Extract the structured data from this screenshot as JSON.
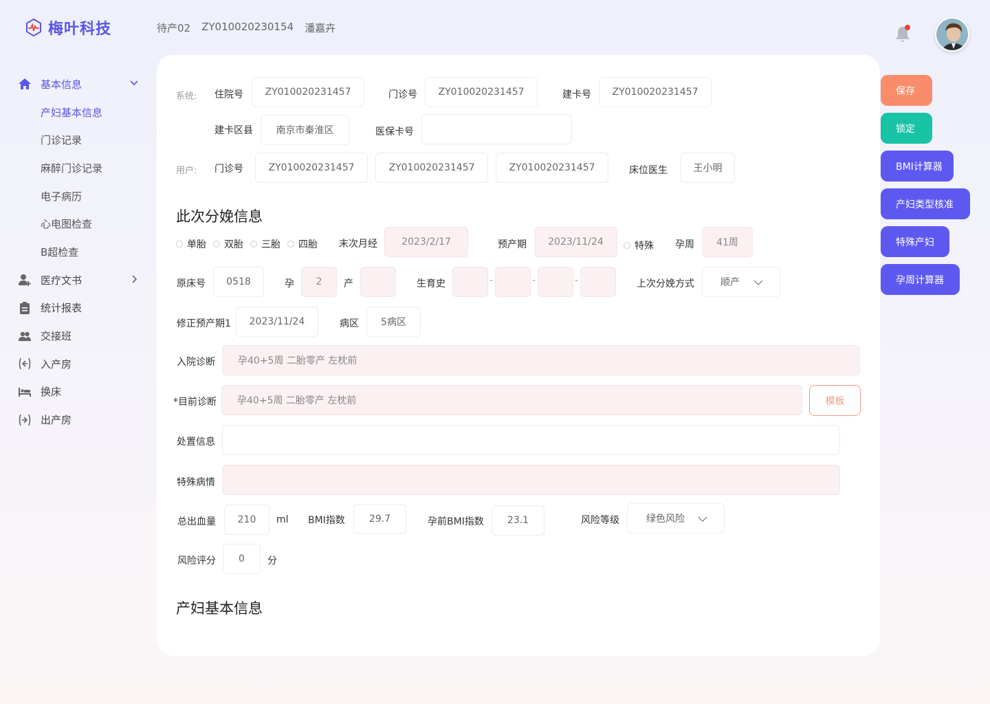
{
  "app": {
    "logo_text": "梅叶科技"
  },
  "header": {
    "status": "待产02",
    "record_no": "ZY010020230154",
    "patient_name": "潘嘉卉"
  },
  "sidebar": {
    "items": [
      {
        "label": "基本信息",
        "icon": "home-icon"
      },
      {
        "label": "产妇基本信息"
      },
      {
        "label": "门诊记录"
      },
      {
        "label": "麻醉门诊记录"
      },
      {
        "label": "电子病历"
      },
      {
        "label": "心电图检查"
      },
      {
        "label": "B超检查"
      },
      {
        "label": "医疗文书",
        "icon": "user-add-icon"
      },
      {
        "label": "统计报表",
        "icon": "clipboard-icon"
      },
      {
        "label": "交接班",
        "icon": "users-icon"
      },
      {
        "label": "入产房",
        "icon": "enter-room-icon"
      },
      {
        "label": "换床",
        "icon": "bed-icon"
      },
      {
        "label": "出产房",
        "icon": "exit-room-icon"
      }
    ]
  },
  "form": {
    "system_label": "系统:",
    "user_label": "用户:",
    "hospital_no_label": "住院号",
    "hospital_no": "ZY010020231457",
    "clinic_no_label": "门诊号",
    "clinic_no": "ZY010020231457",
    "card_no_label": "建卡号",
    "card_no": "ZY010020231457",
    "card_district_label": "建卡区县",
    "card_district": "南京市秦淮区",
    "insurance_label": "医保卡号",
    "insurance": "",
    "user_clinic_label": "门诊号",
    "user_clinic_1": "ZY010020231457",
    "user_clinic_2": "ZY010020231457",
    "user_clinic_3": "ZY010020231457",
    "bed_doctor_label": "床位医生",
    "bed_doctor": "王小明"
  },
  "delivery": {
    "section_title": "此次分娩信息",
    "fetus_options": [
      "单胎",
      "双胎",
      "三胎",
      "四胎"
    ],
    "lmp_label": "末次月经",
    "lmp": "2023/2/17",
    "edd_label": "预产期",
    "edd": "2023/11/24",
    "special_label": "特殊",
    "ga_label": "孕周",
    "ga": "41周",
    "orig_bed_label": "原床号",
    "orig_bed": "0518",
    "gravida_label": "孕",
    "gravida": "2",
    "para_label": "产",
    "para": "",
    "history_label": "生育史",
    "history_sep": "-",
    "last_delivery_label": "上次分娩方式",
    "last_delivery": "顺产",
    "corrected_edd_label": "修正预产期1",
    "corrected_edd": "2023/11/24",
    "ward_label": "病区",
    "ward": "5病区",
    "admit_diag_label": "入院诊断",
    "admit_diag": "孕40+5周 二胎零产 左枕前",
    "current_diag_label": "*目前诊断",
    "current_diag": "孕40+5周 二胎零产 左枕前",
    "template_btn": "模板",
    "treatment_label": "处置信息",
    "treatment": "",
    "special_cond_label": "特殊病情",
    "special_cond": "",
    "blood_loss_label": "总出血量",
    "blood_loss": "210",
    "blood_loss_unit": "ml",
    "bmi_label": "BMI指数",
    "bmi": "29.7",
    "pre_bmi_label": "孕前BMI指数",
    "pre_bmi": "23.1",
    "risk_level_label": "风险等级",
    "risk_level": "绿色风险",
    "risk_score_label": "风险评分",
    "risk_score": "0",
    "risk_score_unit": "分"
  },
  "basic_section_title": "产妇基本信息",
  "actions": {
    "save": "保存",
    "lock": "锁定",
    "bmi_calc": "BMI计算器",
    "type_check": "产妇类型核准",
    "special": "特殊产妇",
    "ga_calc": "孕周计算器"
  },
  "colors": {
    "primary": "#5a55e6",
    "save": "#f98d6b",
    "lock": "#19c3a6",
    "purple_btn": "#5d59f0",
    "pink_field": "#fbf1f2",
    "alert_dot": "#e8413a"
  }
}
